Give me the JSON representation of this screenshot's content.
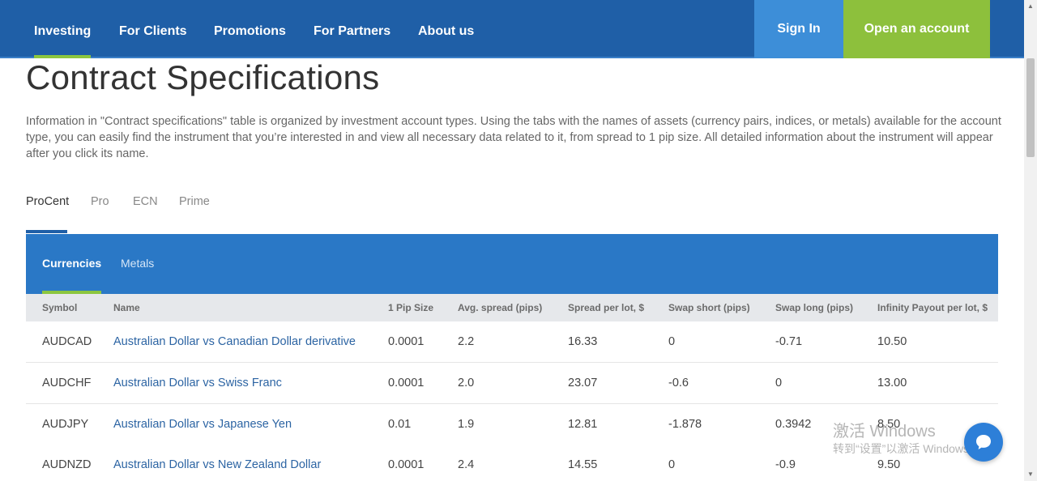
{
  "nav": {
    "items": [
      "Investing",
      "For Clients",
      "Promotions",
      "For Partners",
      "About us"
    ],
    "sign_in": "Sign In",
    "open_account": "Open an account"
  },
  "page": {
    "title": "Contract Specifications",
    "intro": "Information in \"Contract specifications\" table is organized by investment account types. Using the tabs with the names of assets (currency pairs, indices, or metals) available for the account type, you can easily find the instrument that you’re interested in and view all necessary data related to it, from spread to 1 pip size. All detailed information about the instrument will appear after you click its name."
  },
  "account_tabs": [
    "ProCent",
    "Pro",
    "ECN",
    "Prime"
  ],
  "asset_tabs": [
    "Currencies",
    "Metals"
  ],
  "table": {
    "headers": [
      "Symbol",
      "Name",
      "1 Pip Size",
      "Avg. spread (pips)",
      "Spread per lot, $",
      "Swap short (pips)",
      "Swap long (pips)",
      "Infinity Payout per lot, $"
    ],
    "rows": [
      [
        "AUDCAD",
        "Australian Dollar vs Canadian Dollar derivative",
        "0.0001",
        "2.2",
        "16.33",
        "0",
        "-0.71",
        "10.50"
      ],
      [
        "AUDCHF",
        "Australian Dollar vs Swiss Franc",
        "0.0001",
        "2.0",
        "23.07",
        "-0.6",
        "0",
        "13.00"
      ],
      [
        "AUDJPY",
        "Australian Dollar vs Japanese Yen",
        "0.01",
        "1.9",
        "12.81",
        "-1.878",
        "0.3942",
        "8.50"
      ],
      [
        "AUDNZD",
        "Australian Dollar vs New Zealand Dollar",
        "0.0001",
        "2.4",
        "14.55",
        "0",
        "-0.9",
        "9.50"
      ]
    ]
  },
  "watermark": {
    "line1": "激活 Windows",
    "line2": "转到“设置”以激活 Windows。"
  },
  "icons": {
    "chat": "chat-bubble-icon",
    "scroll_up": "scroll-up-arrow-icon",
    "scroll_down": "scroll-down-arrow-icon"
  },
  "colors": {
    "nav_bg": "#1f5fa7",
    "sign_in_bg": "#3d8ed8",
    "open_account_bg": "#8dc03c",
    "asset_bar_bg": "#2a78c6",
    "active_underline": "#8cc63f",
    "link": "#2c64a3"
  }
}
